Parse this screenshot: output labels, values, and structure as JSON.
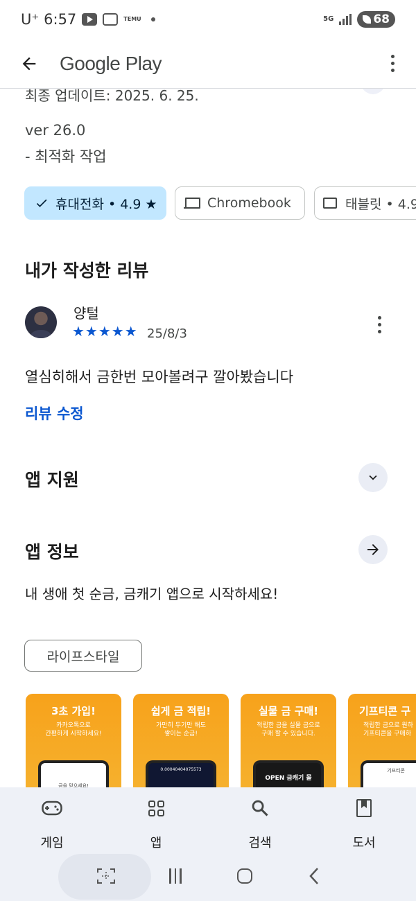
{
  "status_bar": {
    "carrier_time": "U⁺ 6:57",
    "temu_label": "TEMU",
    "network": "5G",
    "battery": "68"
  },
  "app_bar": {
    "title": "Google Play"
  },
  "whats_new": {
    "updated_partial": "최종 업데이트: 2025. 6. 25.",
    "version": "ver 26.0",
    "note": "- 최적화 작업"
  },
  "device_chips": [
    {
      "label": "휴대전화 • 4.9 ★",
      "selected": true
    },
    {
      "label": "Chromebook",
      "selected": false
    },
    {
      "label": "태블릿 • 4.9",
      "selected": false
    }
  ],
  "my_review": {
    "section_title": "내가 작성한 리뷰",
    "reviewer_name": "양털",
    "rating": 5,
    "stars_text": "★★★★★",
    "date": "25/8/3",
    "text": "열심히해서 금한번 모아볼려구 깔아봤습니다",
    "edit_label": "리뷰 수정"
  },
  "app_support": {
    "title": "앱 지원"
  },
  "app_info": {
    "title": "앱 정보",
    "description": "내 생애 첫 순금, 금캐기 앱으로 시작하세요!",
    "category": "라이프스타일"
  },
  "screenshots": [
    {
      "title": "3초 가입!",
      "subtitle": "카카오톡으로\n간편하게 시작하세요!",
      "screen_text": "금을 믿으세요!"
    },
    {
      "title": "쉽게 금 적립!",
      "subtitle": "가만히 두기만 해도\n쌓이는 순금!",
      "screen_text": "0.00040404075573"
    },
    {
      "title": "실물 금 구매!",
      "subtitle": "적립한 금을 실물 금으로\n구매 할 수 있습니다.",
      "screen_text": "OPEN 금캐기 몰"
    },
    {
      "title": "기프티콘 구",
      "subtitle": "적립한 금으로 원하\n기프티콘을 구매하",
      "screen_text": "기프티콘"
    }
  ],
  "bottom_nav": [
    {
      "label": "게임",
      "icon": "gamepad-icon"
    },
    {
      "label": "앱",
      "icon": "apps-grid-icon"
    },
    {
      "label": "검색",
      "icon": "search-icon"
    },
    {
      "label": "도서",
      "icon": "book-icon"
    }
  ],
  "colors": {
    "accent_blue": "#0b57d0",
    "chip_selected_bg": "#c2e7ff",
    "screenshot_orange": "#f7a21b",
    "nav_bg": "#eef1f7"
  }
}
